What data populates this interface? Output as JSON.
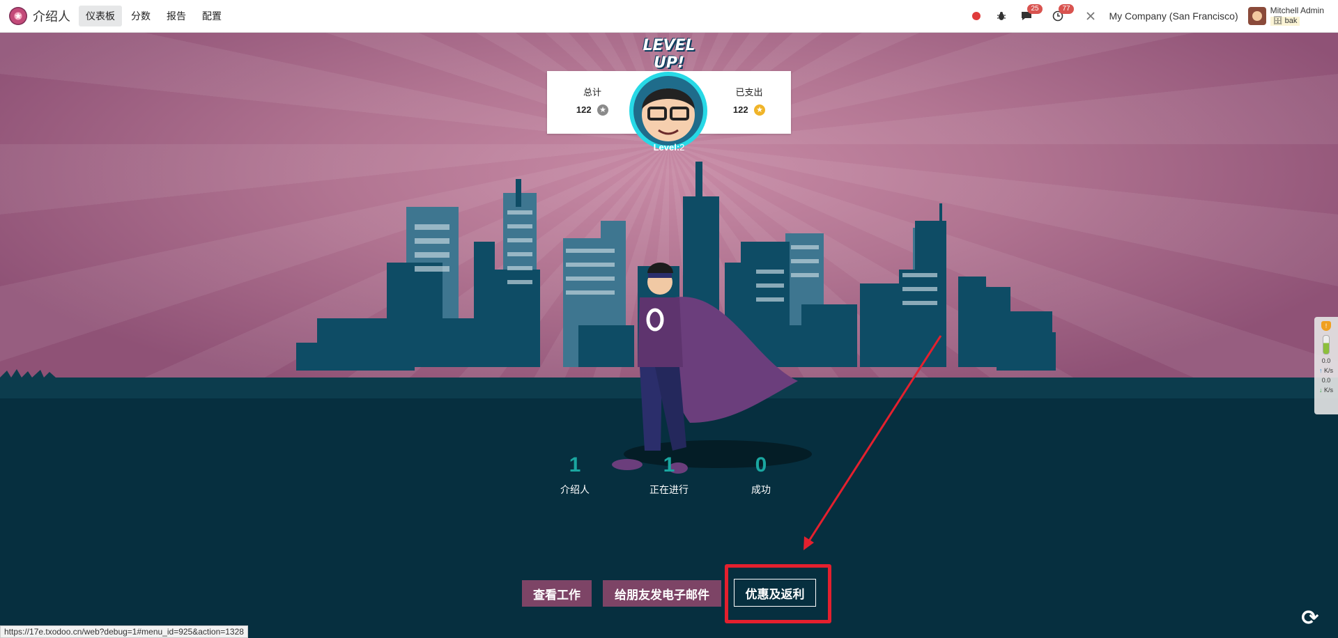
{
  "navbar": {
    "app_name": "介绍人",
    "menu": [
      {
        "label": "仪表板",
        "active": true
      },
      {
        "label": "分数"
      },
      {
        "label": "报告"
      },
      {
        "label": "配置"
      }
    ],
    "messages_count": "25",
    "activities_count": "77",
    "company": "My Company (San Francisco)",
    "user_name": "Mitchell Admin",
    "database": "bak"
  },
  "points": {
    "total_label": "总计",
    "total_value": "122",
    "spent_label": "已支出",
    "spent_value": "122"
  },
  "level": {
    "banner": "LEVEL UP!",
    "label": "Level:",
    "value": "2"
  },
  "stats": [
    {
      "value": "1",
      "label": "介绍人"
    },
    {
      "value": "1",
      "label": "正在进行"
    },
    {
      "value": "0",
      "label": "成功"
    }
  ],
  "buttons": {
    "view_jobs": "查看工作",
    "email_friends": "给朋友发电子邮件",
    "rewards": "优惠及返利"
  },
  "side_widget": {
    "up_rate": "0.0",
    "up_unit": "K/s",
    "down_rate": "0.0",
    "down_unit": "K/s"
  },
  "status_bar_url": "https://17e.txodoo.cn/web?debug=1#menu_id=925&action=1328",
  "colors": {
    "accent": "#7d4466",
    "stat_number": "#1aa6a0",
    "annotation_red": "#e4202e",
    "ground": "#072a37"
  },
  "icons": [
    "app-logo-icon",
    "record-dot-icon",
    "bug-icon",
    "chat-icon",
    "clock-icon",
    "tools-icon",
    "refresh-icon"
  ]
}
